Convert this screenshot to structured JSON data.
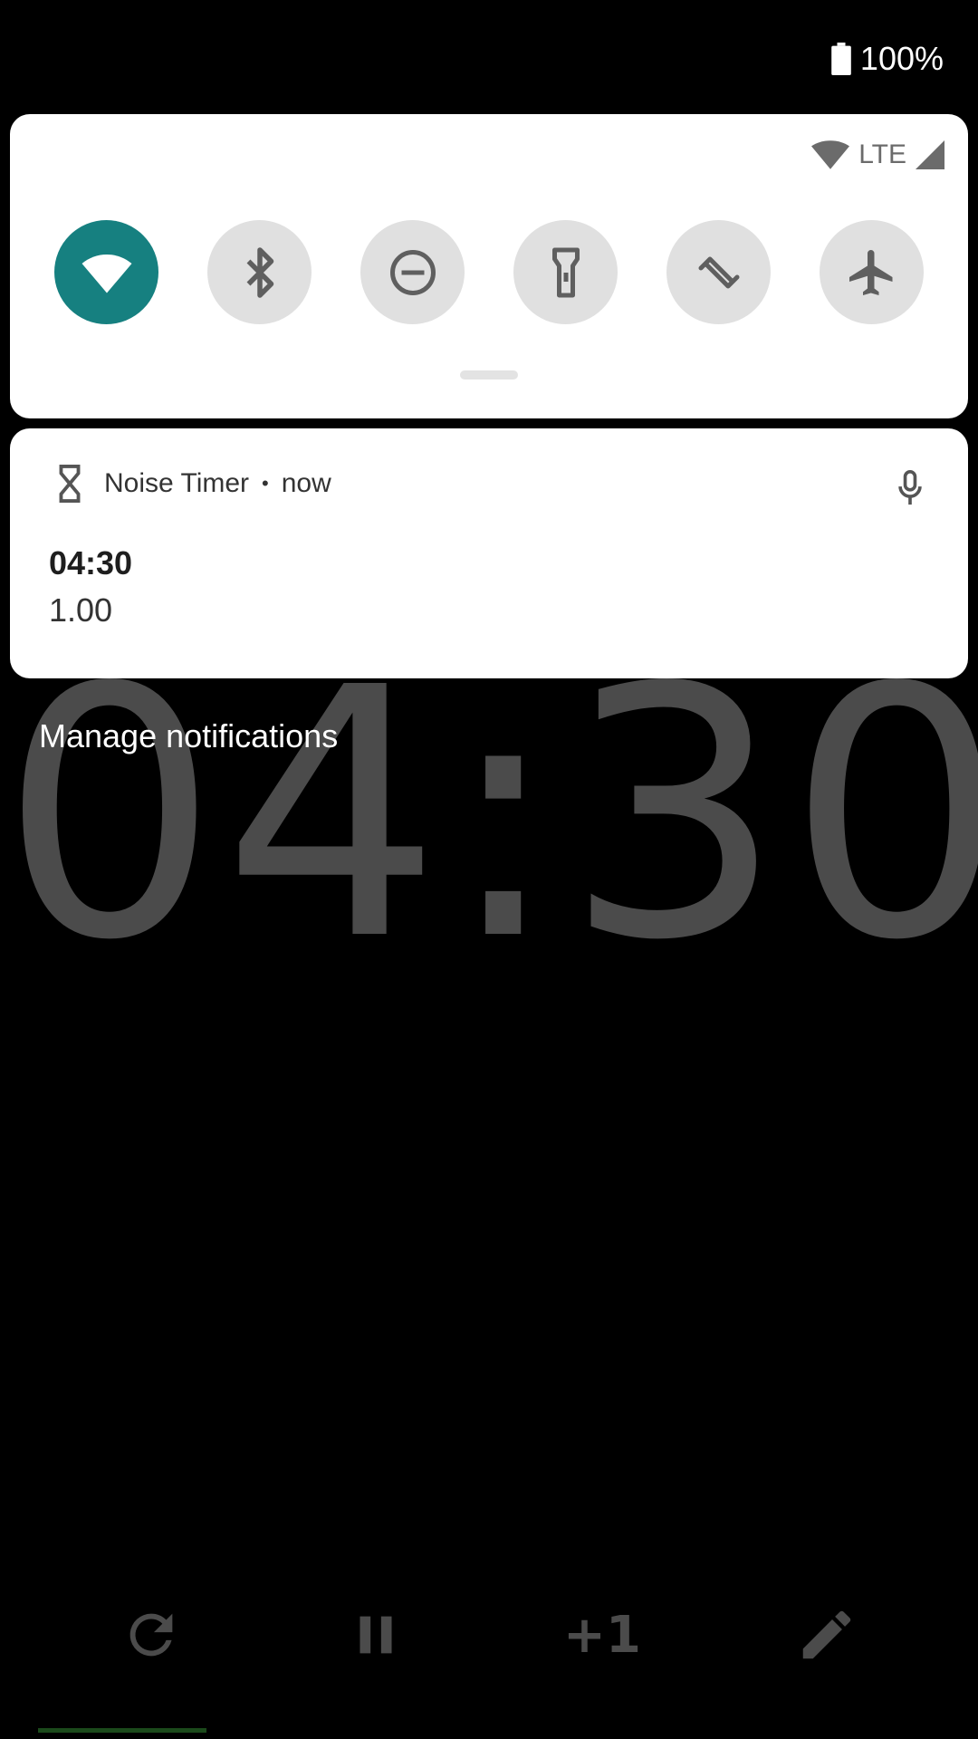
{
  "status_bar": {
    "battery": "100%",
    "icons": [
      "battery-icon"
    ]
  },
  "quick_settings": {
    "network": "LTE",
    "tiles": [
      {
        "name": "wifi",
        "icon": "wifi-icon",
        "active": true
      },
      {
        "name": "bluetooth",
        "icon": "bluetooth-icon",
        "active": false
      },
      {
        "name": "do-not-disturb",
        "icon": "dnd-icon",
        "active": false
      },
      {
        "name": "flashlight",
        "icon": "flashlight-icon",
        "active": false
      },
      {
        "name": "auto-rotate",
        "icon": "rotate-icon",
        "active": false
      },
      {
        "name": "airplane-mode",
        "icon": "airplane-icon",
        "active": false
      }
    ],
    "accent": "#168080"
  },
  "notification": {
    "app_name": "Noise Timer",
    "separator": "•",
    "time": "now",
    "title": "04:30",
    "text": "1.00"
  },
  "manage_notifications": "Manage notifications",
  "app": {
    "timer": "04:30",
    "plus_one": "+1",
    "controls": [
      "refresh-icon",
      "pause-icon",
      "plus-one",
      "edit-icon"
    ]
  }
}
